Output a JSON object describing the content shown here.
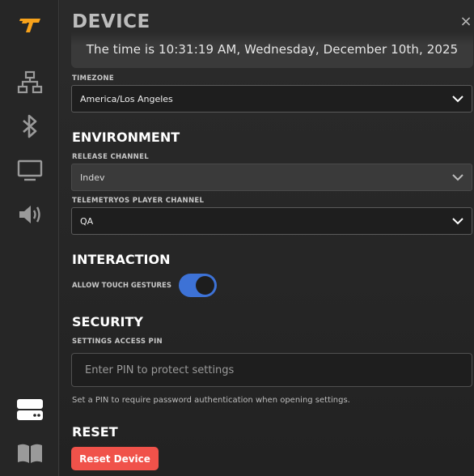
{
  "app": {
    "brand_colors": {
      "logo": "#f7a21b",
      "accent": "#3d72d6",
      "danger": "#f0524a"
    }
  },
  "sidebar": {
    "items": [
      {
        "icon": "logo-icon"
      },
      {
        "icon": "network-icon"
      },
      {
        "icon": "bluetooth-icon"
      },
      {
        "icon": "display-icon"
      },
      {
        "icon": "audio-icon"
      },
      {
        "icon": "device-icon"
      },
      {
        "icon": "book-icon"
      }
    ]
  },
  "header": {
    "title": "DEVICE",
    "close_label": "×"
  },
  "time": {
    "text": "The time is 10:31:19 AM, Wednesday, December 10th, 2025"
  },
  "timezone": {
    "label": "TIMEZONE",
    "value": "America/Los Angeles"
  },
  "environment": {
    "title": "ENVIRONMENT",
    "release_channel": {
      "label": "RELEASE CHANNEL",
      "value": "Indev"
    },
    "player_channel": {
      "label": "TELEMETRYOS PLAYER CHANNEL",
      "value": "QA"
    }
  },
  "interaction": {
    "title": "INTERACTION",
    "touch_gestures": {
      "label": "ALLOW TOUCH GESTURES",
      "enabled": true
    }
  },
  "security": {
    "title": "SECURITY",
    "pin": {
      "label": "SETTINGS ACCESS PIN",
      "value": "",
      "placeholder": "Enter PIN to protect settings",
      "helper": "Set a PIN to require password authentication when opening settings."
    }
  },
  "reset": {
    "title": "RESET",
    "button_label": "Reset Device"
  }
}
